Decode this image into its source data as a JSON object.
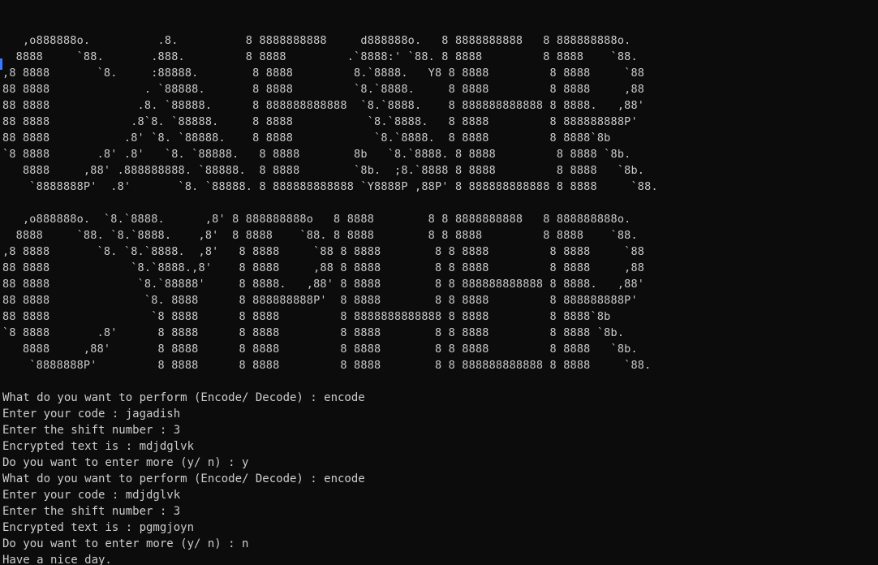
{
  "banner_lines": [
    "",
    "   ,o888888o.          .8.          8 8888888888     d888888o.   8 8888888888   8 888888888o.",
    "  8888     `88.       .888.         8 8888         .`8888:' `88. 8 8888         8 8888    `88.",
    ",8 8888       `8.     :88888.        8 8888         8.`8888.   Y8 8 8888         8 8888     `88",
    "88 8888              . `88888.       8 8888         `8.`8888.     8 8888         8 8888     ,88",
    "88 8888             .8. `88888.      8 888888888888  `8.`8888.    8 888888888888 8 8888.   ,88'",
    "88 8888            .8`8. `88888.     8 8888           `8.`8888.   8 8888         8 888888888P'",
    "88 8888           .8' `8. `88888.    8 8888            `8.`8888.  8 8888         8 8888`8b",
    "`8 8888       .8' .8'   `8. `88888.   8 8888        8b   `8.`8888. 8 8888         8 8888 `8b.",
    "   8888     ,88' .888888888. `88888.  8 8888        `8b.  ;8.`8888 8 8888         8 8888   `8b.",
    "    `8888888P'  .8'       `8. `88888. 8 888888888888 `Y8888P ,88P' 8 888888888888 8 8888     `88.",
    "",
    "   ,o888888o.  `8.`8888.      ,8' 8 888888888o   8 8888        8 8 8888888888   8 888888888o.",
    "  8888     `88. `8.`8888.    ,8'  8 8888    `88. 8 8888        8 8 8888         8 8888    `88.",
    ",8 8888       `8. `8.`8888.  ,8'   8 8888     `88 8 8888        8 8 8888         8 8888     `88",
    "88 8888            `8.`8888.,8'    8 8888     ,88 8 8888        8 8 8888         8 8888     ,88",
    "88 8888             `8.`88888'     8 8888.   ,88' 8 8888        8 8 888888888888 8 8888.   ,88'",
    "88 8888              `8. 8888      8 888888888P'  8 8888        8 8 8888         8 888888888P'",
    "88 8888               `8 8888      8 8888         8 8888888888888 8 8888         8 8888`8b",
    "`8 8888       .8'      8 8888      8 8888         8 8888        8 8 8888         8 8888 `8b.",
    "   8888     ,88'       8 8888      8 8888         8 8888        8 8 8888         8 8888   `8b.",
    "    `8888888P'         8 8888      8 8888         8 8888        8 8 888888888888 8 8888     `88.",
    ""
  ],
  "session_lines": [
    "What do you want to perform (Encode/ Decode) : encode",
    "Enter your code : jagadish",
    "Enter the shift number : 3",
    "Encrypted text is : mdjdglvk",
    "Do you want to enter more (y/ n) : y",
    "What do you want to perform (Encode/ Decode) : encode",
    "Enter your code : mdjdglvk",
    "Enter the shift number : 3",
    "Encrypted text is : pgmgjoyn",
    "Do you want to enter more (y/ n) : n",
    "Have a nice day."
  ],
  "colors": {
    "background": "#0c0c0c",
    "foreground": "#cccccc",
    "cursor_marker": "#3b78ff"
  }
}
